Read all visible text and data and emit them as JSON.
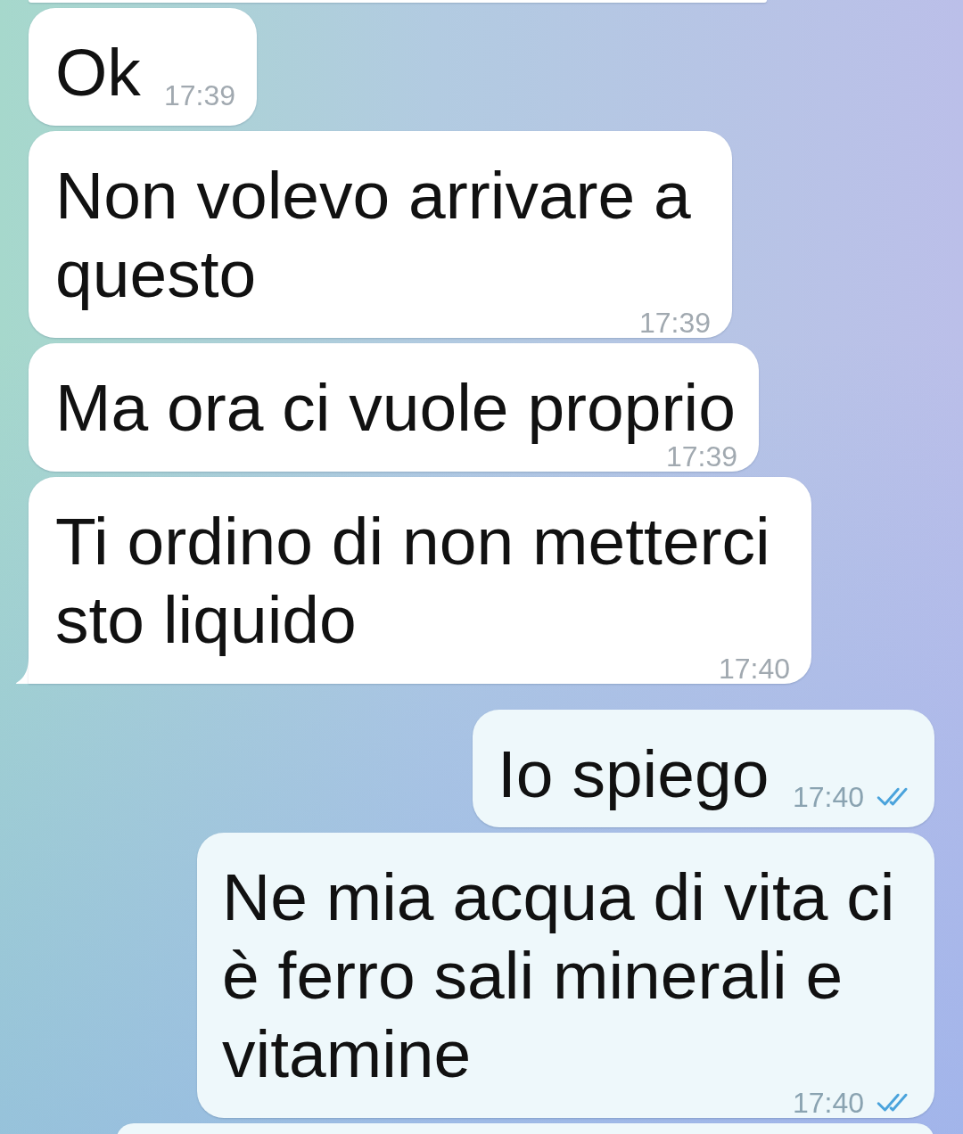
{
  "messages": [
    {
      "kind": "cut_off",
      "outgoing": false
    },
    {
      "kind": "text",
      "outgoing": false,
      "text": "Ok",
      "time": "17:39",
      "tail": false
    },
    {
      "kind": "text",
      "outgoing": false,
      "text": "Non volevo arrivare a questo",
      "time": "17:39",
      "tail": false
    },
    {
      "kind": "text",
      "outgoing": false,
      "text": "Ma ora ci vuole proprio",
      "time": "17:39",
      "tail": false
    },
    {
      "kind": "text",
      "outgoing": false,
      "text": "Ti ordino di non metterci sto liquido",
      "time": "17:40",
      "tail": true
    },
    {
      "kind": "text",
      "outgoing": true,
      "text": "Io spiego",
      "time": "17:40",
      "read": true,
      "tail": false
    },
    {
      "kind": "text",
      "outgoing": true,
      "text": "Ne mia acqua di vita ci è ferro sali minerali e vitamine",
      "time": "17:40",
      "read": true,
      "tail": false
    },
    {
      "kind": "cut_off",
      "outgoing": true
    }
  ]
}
